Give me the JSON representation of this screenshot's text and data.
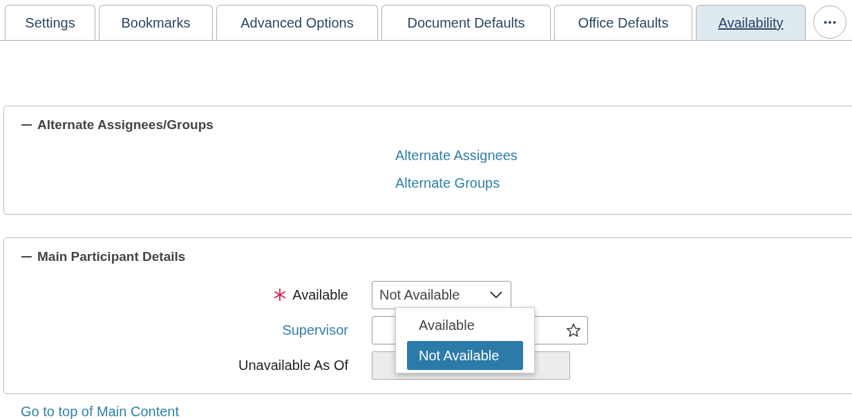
{
  "tabs": [
    {
      "label": "Settings",
      "selected": false
    },
    {
      "label": "Bookmarks",
      "selected": false
    },
    {
      "label": "Advanced Options",
      "selected": false
    },
    {
      "label": "Document Defaults",
      "selected": false
    },
    {
      "label": "Office Defaults",
      "selected": false
    },
    {
      "label": "Availability",
      "selected": true
    }
  ],
  "sections": [
    {
      "title": "Alternate Assignees/Groups",
      "expanded": true,
      "kind": "links",
      "links": [
        "Alternate Assignees",
        "Alternate Groups"
      ]
    },
    {
      "title": "Main Participant Details",
      "expanded": true,
      "kind": "form",
      "fields": [
        {
          "label": "Available",
          "required": true,
          "label_is_link": false,
          "kind": "select",
          "value": "Not Available",
          "disabled": false
        },
        {
          "label": "Supervisor",
          "required": false,
          "label_is_link": true,
          "kind": "lookup",
          "disabled": false
        },
        {
          "label": "Unavailable As Of",
          "required": false,
          "label_is_link": false,
          "kind": "date",
          "disabled": true
        }
      ],
      "dropdown": {
        "options": [
          {
            "label": "Available",
            "selected": false
          },
          {
            "label": "Not Available",
            "selected": true
          }
        ]
      }
    }
  ],
  "footer_link": "Go to top of Main Content"
}
